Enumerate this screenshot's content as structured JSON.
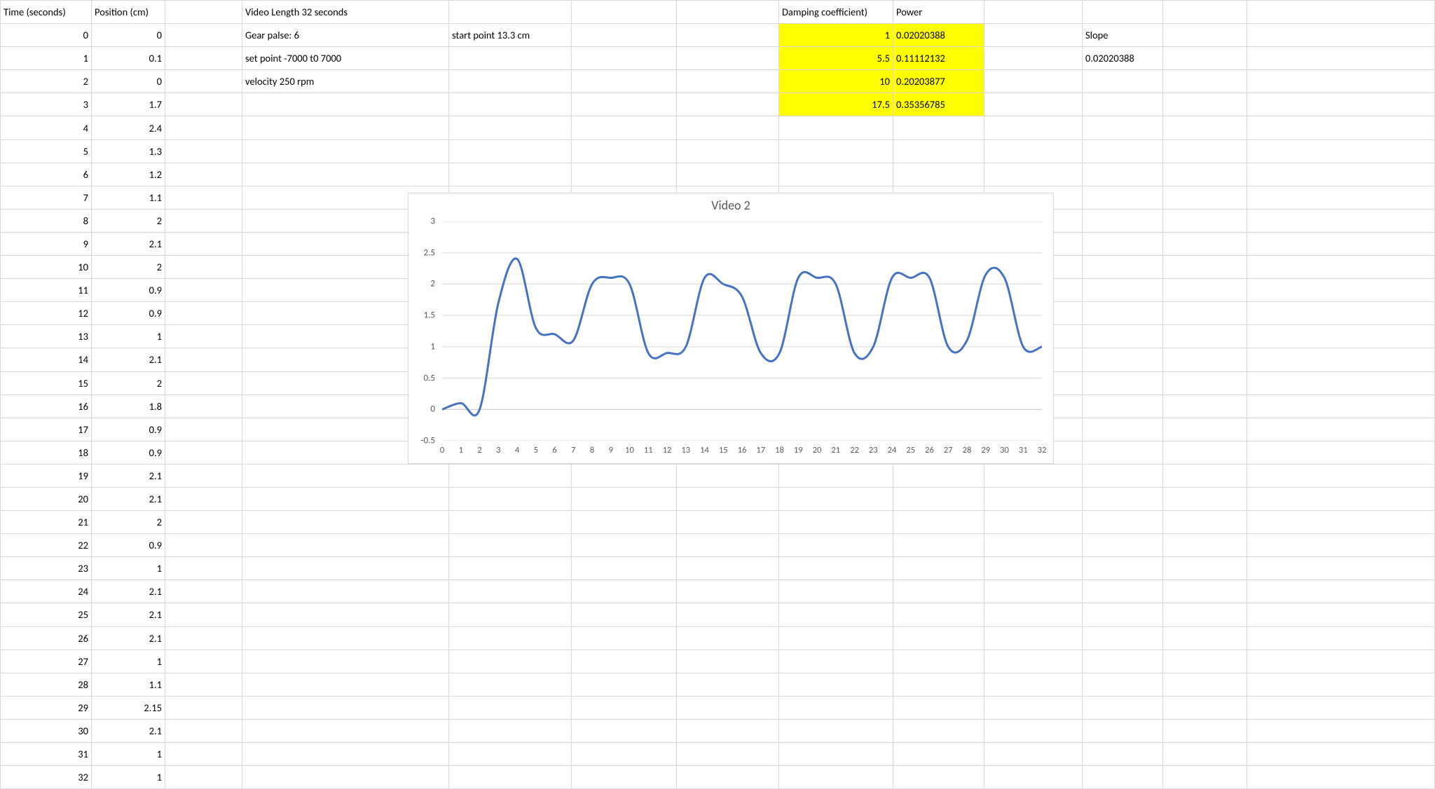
{
  "headers": {
    "time": "Time (seconds)",
    "position": "Position (cm)",
    "damping": "Damping coefficient)",
    "power": "Power",
    "slope": "Slope"
  },
  "notes": {
    "video_length": "Video Length 32 seconds",
    "gear_palse": "Gear palse: 6",
    "set_point": "set point -7000 t0 7000",
    "velocity": "velocity 250 rpm",
    "start_point": "start point 13.3 cm"
  },
  "slope_value": "0.02020388",
  "damping_table": [
    {
      "d": "1",
      "p": "0.02020388"
    },
    {
      "d": "5.5",
      "p": "0.11112132"
    },
    {
      "d": "10",
      "p": "0.20203877"
    },
    {
      "d": "17.5",
      "p": "0.35356785"
    }
  ],
  "time_position": [
    {
      "t": "0",
      "p": "0"
    },
    {
      "t": "1",
      "p": "0.1"
    },
    {
      "t": "2",
      "p": "0"
    },
    {
      "t": "3",
      "p": "1.7"
    },
    {
      "t": "4",
      "p": "2.4"
    },
    {
      "t": "5",
      "p": "1.3"
    },
    {
      "t": "6",
      "p": "1.2"
    },
    {
      "t": "7",
      "p": "1.1"
    },
    {
      "t": "8",
      "p": "2"
    },
    {
      "t": "9",
      "p": "2.1"
    },
    {
      "t": "10",
      "p": "2"
    },
    {
      "t": "11",
      "p": "0.9"
    },
    {
      "t": "12",
      "p": "0.9"
    },
    {
      "t": "13",
      "p": "1"
    },
    {
      "t": "14",
      "p": "2.1"
    },
    {
      "t": "15",
      "p": "2"
    },
    {
      "t": "16",
      "p": "1.8"
    },
    {
      "t": "17",
      "p": "0.9"
    },
    {
      "t": "18",
      "p": "0.9"
    },
    {
      "t": "19",
      "p": "2.1"
    },
    {
      "t": "20",
      "p": "2.1"
    },
    {
      "t": "21",
      "p": "2"
    },
    {
      "t": "22",
      "p": "0.9"
    },
    {
      "t": "23",
      "p": "1"
    },
    {
      "t": "24",
      "p": "2.1"
    },
    {
      "t": "25",
      "p": "2.1"
    },
    {
      "t": "26",
      "p": "2.1"
    },
    {
      "t": "27",
      "p": "1"
    },
    {
      "t": "28",
      "p": "1.1"
    },
    {
      "t": "29",
      "p": "2.15"
    },
    {
      "t": "30",
      "p": "2.1"
    },
    {
      "t": "31",
      "p": "1"
    },
    {
      "t": "32",
      "p": "1"
    }
  ],
  "chart_data": {
    "type": "line",
    "title": "Video 2",
    "xlabel": "",
    "ylabel": "",
    "ylim": [
      -0.5,
      3
    ],
    "yticks": [
      "-0.5",
      "0",
      "0.5",
      "1",
      "1.5",
      "2",
      "2.5",
      "3"
    ],
    "x": [
      0,
      1,
      2,
      3,
      4,
      5,
      6,
      7,
      8,
      9,
      10,
      11,
      12,
      13,
      14,
      15,
      16,
      17,
      18,
      19,
      20,
      21,
      22,
      23,
      24,
      25,
      26,
      27,
      28,
      29,
      30,
      31,
      32
    ],
    "series": [
      {
        "name": "Position (cm)",
        "values": [
          0,
          0.1,
          0,
          1.7,
          2.4,
          1.3,
          1.2,
          1.1,
          2,
          2.1,
          2,
          0.9,
          0.9,
          1,
          2.1,
          2,
          1.8,
          0.9,
          0.9,
          2.1,
          2.1,
          2,
          0.9,
          1,
          2.1,
          2.1,
          2.1,
          1,
          1.1,
          2.15,
          2.1,
          1,
          1
        ]
      }
    ]
  }
}
